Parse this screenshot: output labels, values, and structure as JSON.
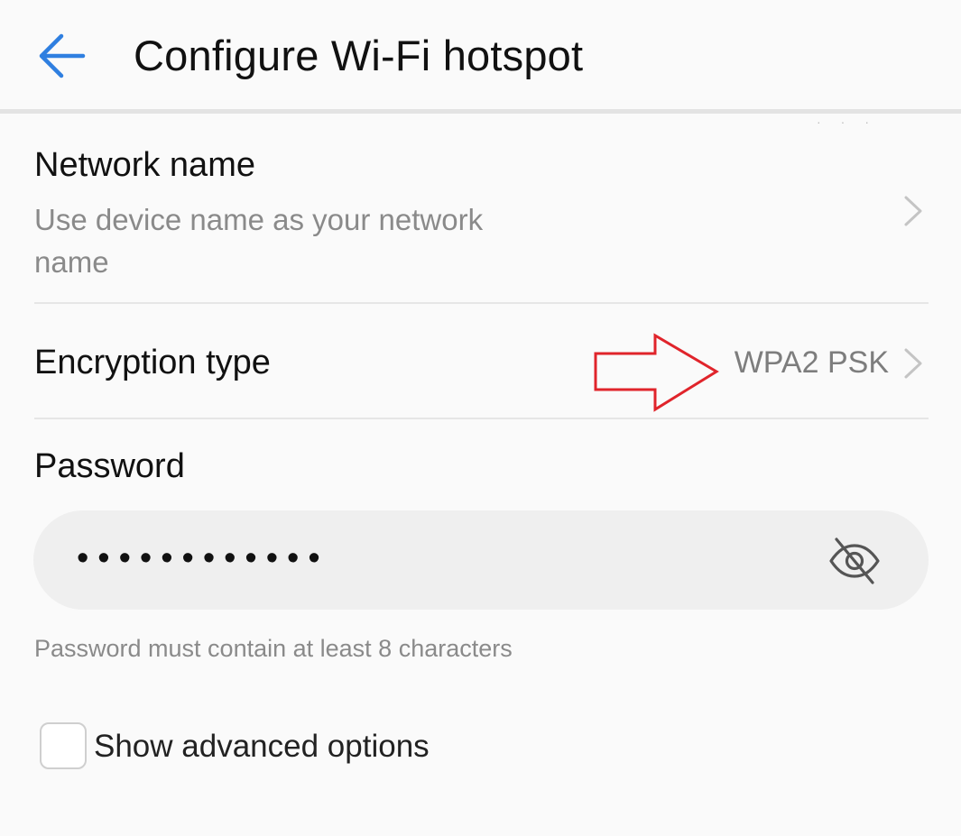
{
  "header": {
    "title": "Configure Wi-Fi hotspot"
  },
  "network_name": {
    "title": "Network name",
    "subtitle": "Use device name as your network name"
  },
  "encryption": {
    "title": "Encryption type",
    "value": "WPA2 PSK"
  },
  "password": {
    "label": "Password",
    "masked_value": "••••••••••••",
    "hint": "Password must contain at least 8 characters"
  },
  "advanced": {
    "label": "Show advanced options",
    "checked": false
  },
  "icons": {
    "back": "arrow-left-icon",
    "chevron": "chevron-right-icon",
    "visibility": "eye-off-icon"
  },
  "colors": {
    "accent": "#2f7fe0",
    "annotation": "#e0242b",
    "background": "#fafafa"
  }
}
